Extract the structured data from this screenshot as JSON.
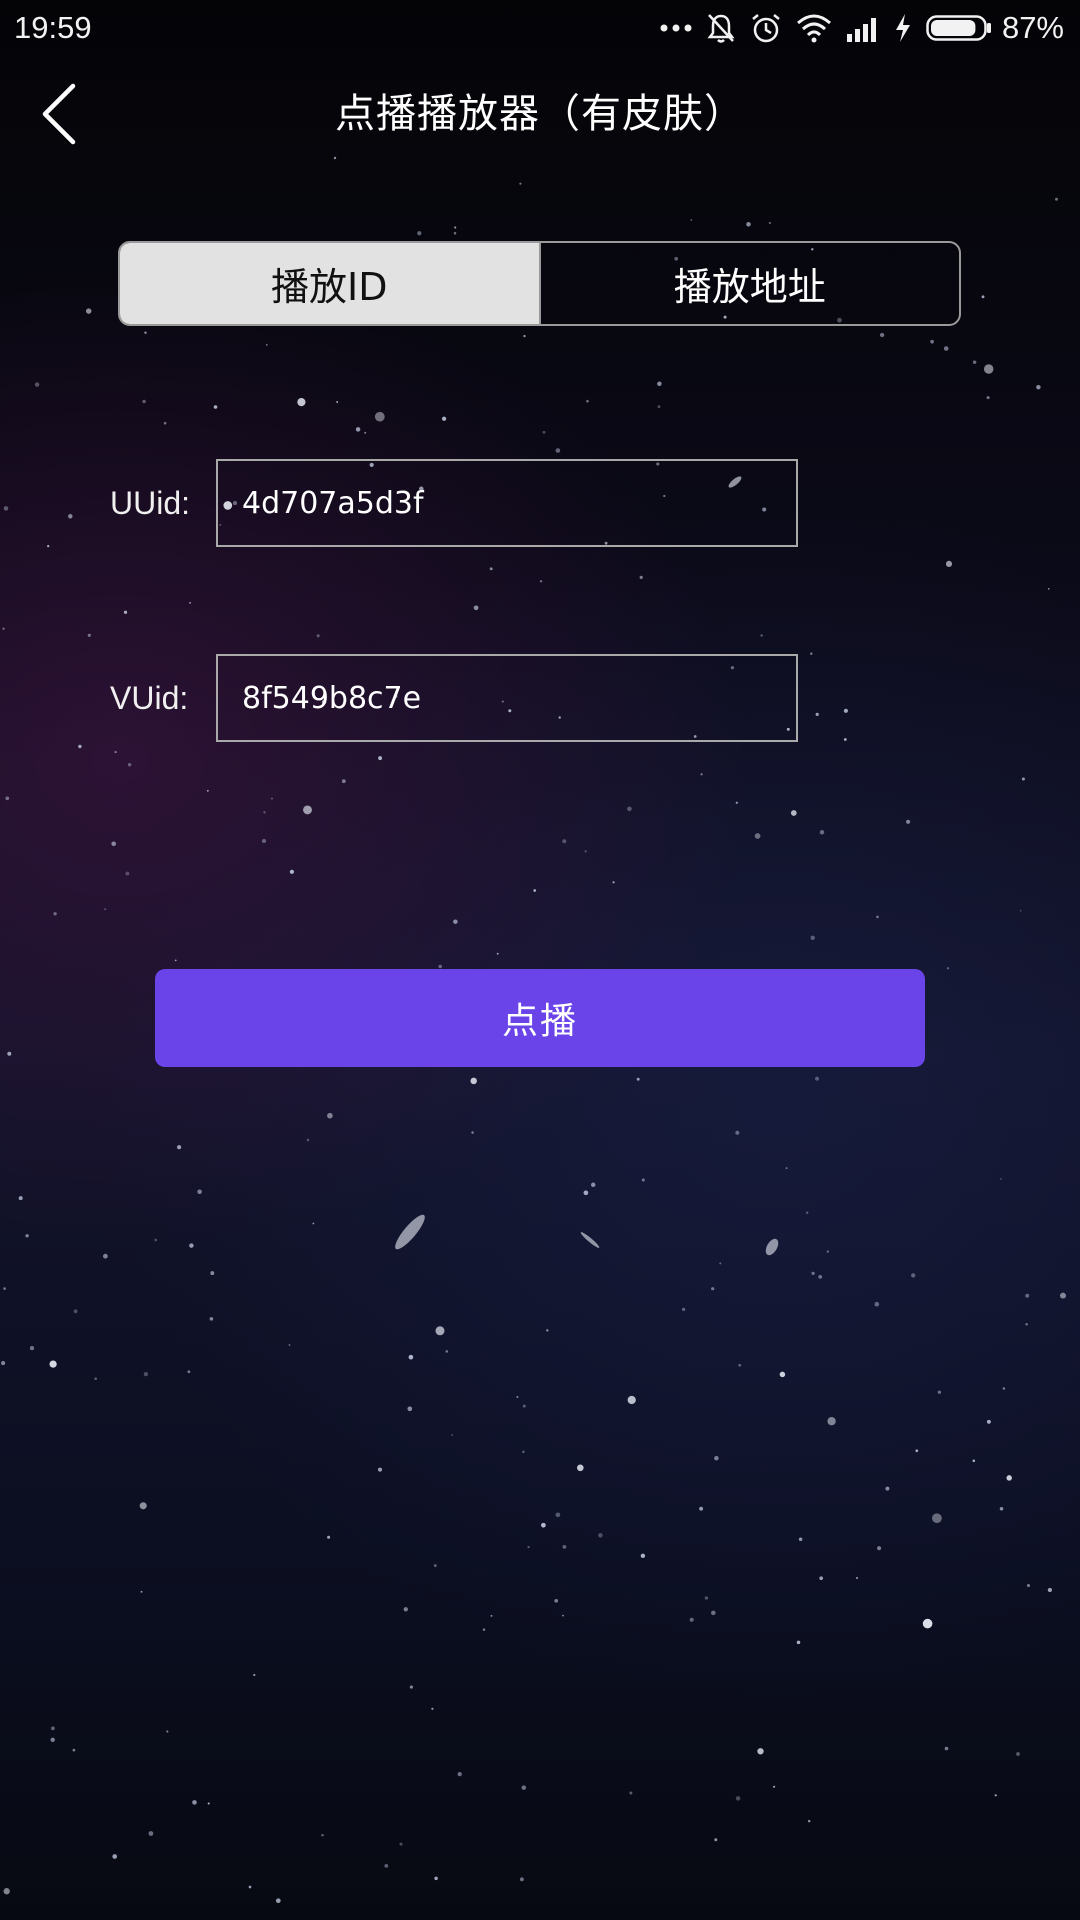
{
  "status_bar": {
    "time": "19:59",
    "battery_percent": "87%",
    "battery_level": 0.87,
    "icons": [
      "more-dots-icon",
      "bell-muted-icon",
      "alarm-clock-icon",
      "wifi-icon",
      "cell-signal-icon",
      "charging-bolt-icon",
      "battery-icon"
    ]
  },
  "header": {
    "title": "点播播放器（有皮肤）",
    "back_icon": "chevron-left-icon"
  },
  "tabs": {
    "play_id": "播放ID",
    "play_url": "播放地址",
    "active": "play_id"
  },
  "form": {
    "uuid_label": "UUid:",
    "uuid_value": "4d707a5d3f",
    "vuid_label": "VUid:",
    "vuid_value": "8f549b8c7e"
  },
  "play_button": {
    "label": "点播"
  },
  "colors": {
    "accent": "#6a44e8",
    "active_tab_bg": "#e2e2e2",
    "border": "#a9a9a9",
    "text": "#ffffff"
  }
}
